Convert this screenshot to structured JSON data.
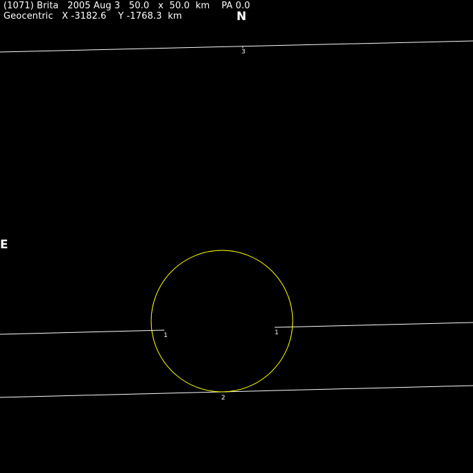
{
  "header": {
    "line1": "(1071) Brita   2005 Aug 3   50.0   x  50.0  km    PA 0.0",
    "line2": "Geocentric   X -3182.6    Y -1768.3  km"
  },
  "directions": {
    "north": "N",
    "east": "E"
  },
  "chord_labels": {
    "chord_3": "3",
    "chord_1_left": "1",
    "chord_1_right": "1",
    "chord_2": "2"
  },
  "colors": {
    "background": "#000000",
    "chord": "#ffffff",
    "ellipse": "#ffff00",
    "text": "#ffffff"
  }
}
